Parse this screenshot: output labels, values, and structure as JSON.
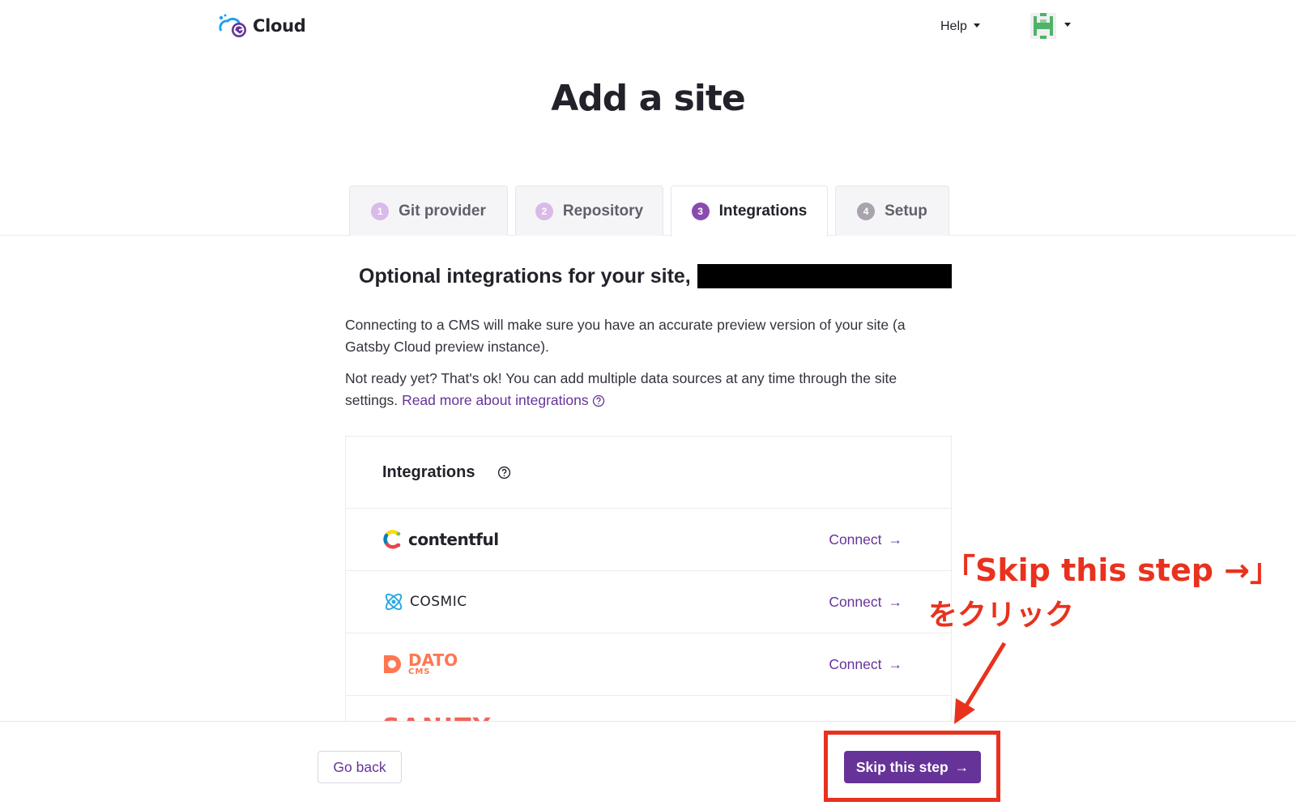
{
  "header": {
    "logo_text": "Cloud",
    "help_label": "Help"
  },
  "page": {
    "title": "Add a site"
  },
  "tabs": [
    {
      "num": "1",
      "label": "Git provider",
      "state": "done"
    },
    {
      "num": "2",
      "label": "Repository",
      "state": "done"
    },
    {
      "num": "3",
      "label": "Integrations",
      "state": "active"
    },
    {
      "num": "4",
      "label": "Setup",
      "state": "upcoming"
    }
  ],
  "content": {
    "heading": "Optional integrations for your site,",
    "paragraph1": "Connecting to a CMS will make sure you have an accurate preview version of your site (a Gatsby Cloud preview instance).",
    "paragraph2": "Not ready yet? That's ok! You can add multiple data sources at any time through the site settings.",
    "read_more_link": "Read more about integrations"
  },
  "integrations": {
    "title": "Integrations",
    "items": [
      {
        "name": "contentful",
        "action": "Connect"
      },
      {
        "name": "COSMIC",
        "action": "Connect"
      },
      {
        "name": "DATO",
        "sub": "CMS",
        "action": "Connect"
      },
      {
        "name": "SANITY"
      }
    ]
  },
  "footer": {
    "go_back": "Go back",
    "skip": "Skip this step"
  },
  "annotation": {
    "line1": "「Skip this step →」",
    "line2": "をクリック",
    "color": "#e8321e"
  },
  "colors": {
    "brand_purple": "#663399",
    "active_step": "#8a4baf"
  }
}
